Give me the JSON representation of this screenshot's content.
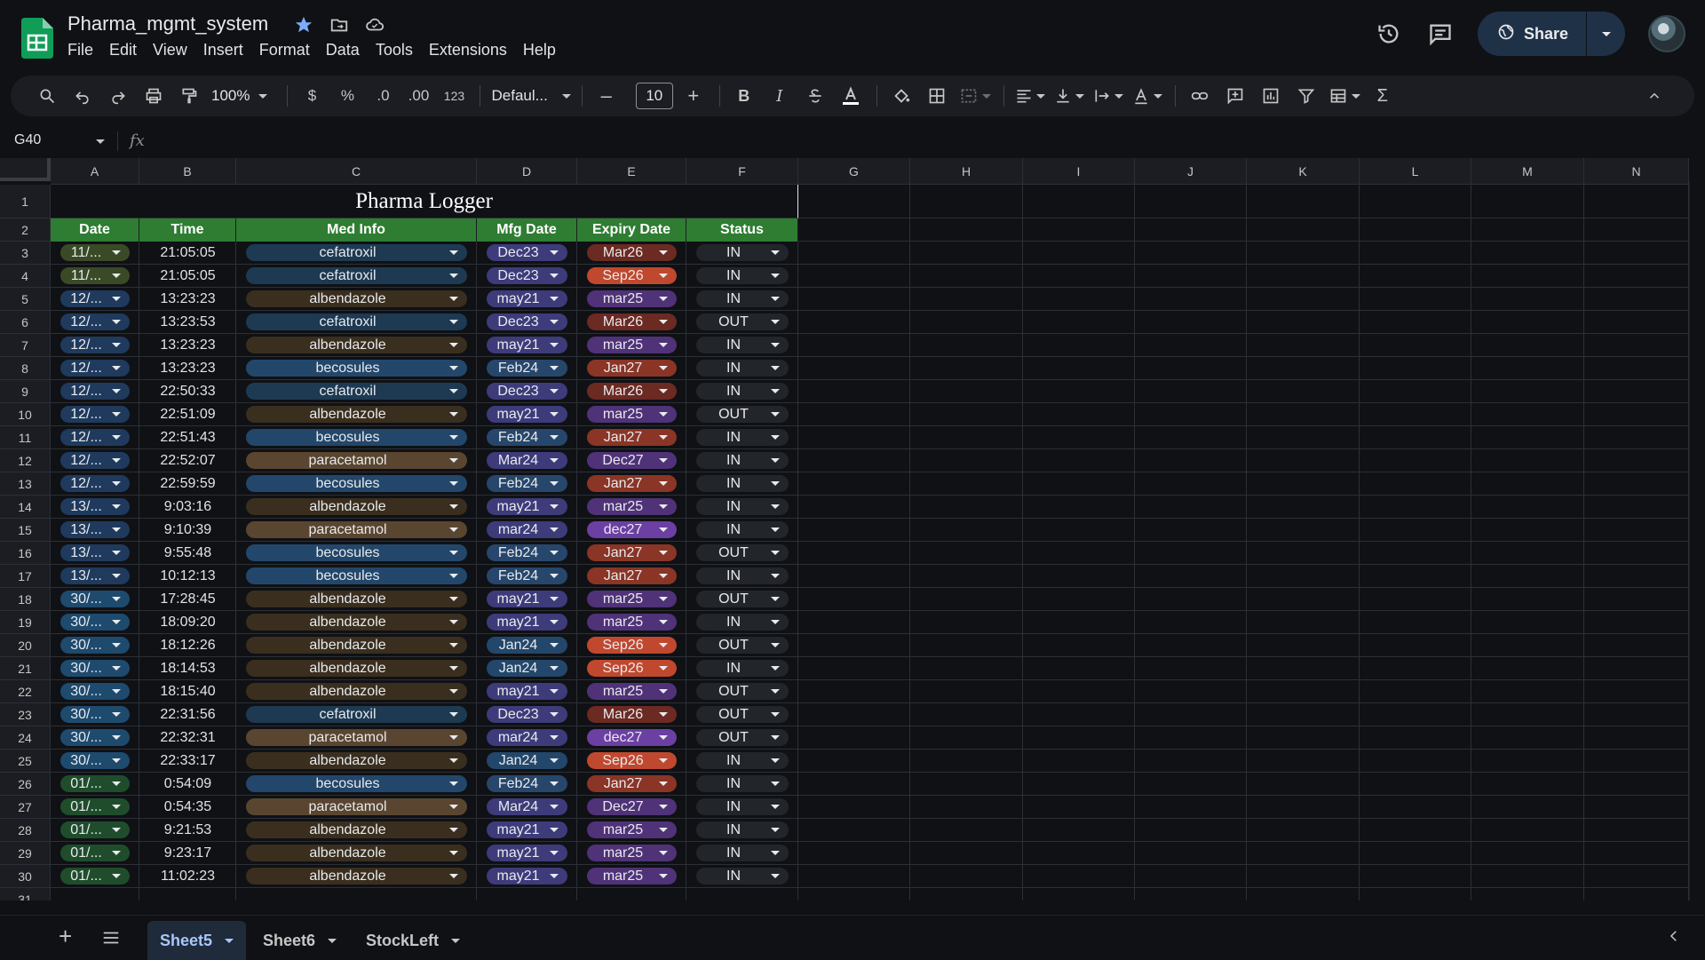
{
  "document": {
    "title": "Pharma_mgmt_system"
  },
  "menu": [
    "File",
    "Edit",
    "View",
    "Insert",
    "Format",
    "Data",
    "Tools",
    "Extensions",
    "Help"
  ],
  "header": {
    "share_label": "Share"
  },
  "toolbar": {
    "zoom": "100%",
    "currency": "$",
    "percent": "%",
    "dec_decrease": ".0",
    "dec_increase": ".00",
    "format_123": "123",
    "font": "Defaul...",
    "font_size": "10",
    "bold": "B",
    "italic": "I"
  },
  "formula_bar": {
    "cell_ref": "G40",
    "fx": "fx"
  },
  "columns": [
    "A",
    "B",
    "C",
    "D",
    "E",
    "F",
    "G",
    "H",
    "I",
    "J",
    "K",
    "L",
    "M",
    "N"
  ],
  "sheet": {
    "title": "Pharma Logger",
    "headers": [
      "Date",
      "Time",
      "Med Info",
      "Mfg Date",
      "Expiry Date",
      "Status"
    ],
    "rows": [
      {
        "n": "3",
        "date": "11/...",
        "time": "21:05:05",
        "med": "cefatroxil",
        "mfg": "Dec23",
        "exp": "Mar26",
        "status": "IN"
      },
      {
        "n": "4",
        "date": "11/...",
        "time": "21:05:05",
        "med": "cefatroxil",
        "mfg": "Dec23",
        "exp": "Sep26",
        "status": "IN"
      },
      {
        "n": "5",
        "date": "12/...",
        "time": "13:23:23",
        "med": "albendazole",
        "mfg": "may21",
        "exp": "mar25",
        "status": "IN"
      },
      {
        "n": "6",
        "date": "12/...",
        "time": "13:23:53",
        "med": "cefatroxil",
        "mfg": "Dec23",
        "exp": "Mar26",
        "status": "OUT"
      },
      {
        "n": "7",
        "date": "12/...",
        "time": "13:23:23",
        "med": "albendazole",
        "mfg": "may21",
        "exp": "mar25",
        "status": "IN"
      },
      {
        "n": "8",
        "date": "12/...",
        "time": "13:23:23",
        "med": "becosules",
        "mfg": "Feb24",
        "exp": "Jan27",
        "status": "IN"
      },
      {
        "n": "9",
        "date": "12/...",
        "time": "22:50:33",
        "med": "cefatroxil",
        "mfg": "Dec23",
        "exp": "Mar26",
        "status": "IN"
      },
      {
        "n": "10",
        "date": "12/...",
        "time": "22:51:09",
        "med": "albendazole",
        "mfg": "may21",
        "exp": "mar25",
        "status": "OUT"
      },
      {
        "n": "11",
        "date": "12/...",
        "time": "22:51:43",
        "med": "becosules",
        "mfg": "Feb24",
        "exp": "Jan27",
        "status": "IN"
      },
      {
        "n": "12",
        "date": "12/...",
        "time": "22:52:07",
        "med": "paracetamol",
        "mfg": "Mar24",
        "exp": "Dec27",
        "status": "IN"
      },
      {
        "n": "13",
        "date": "12/...",
        "time": "22:59:59",
        "med": "becosules",
        "mfg": "Feb24",
        "exp": "Jan27",
        "status": "IN"
      },
      {
        "n": "14",
        "date": "13/...",
        "time": "9:03:16",
        "med": "albendazole",
        "mfg": "may21",
        "exp": "mar25",
        "status": "IN"
      },
      {
        "n": "15",
        "date": "13/...",
        "time": "9:10:39",
        "med": "paracetamol",
        "mfg": "mar24",
        "exp": "dec27",
        "status": "IN"
      },
      {
        "n": "16",
        "date": "13/...",
        "time": "9:55:48",
        "med": "becosules",
        "mfg": "Feb24",
        "exp": "Jan27",
        "status": "OUT"
      },
      {
        "n": "17",
        "date": "13/...",
        "time": "10:12:13",
        "med": "becosules",
        "mfg": "Feb24",
        "exp": "Jan27",
        "status": "IN"
      },
      {
        "n": "18",
        "date": "30/...",
        "time": "17:28:45",
        "med": "albendazole",
        "mfg": "may21",
        "exp": "mar25",
        "status": "OUT"
      },
      {
        "n": "19",
        "date": "30/...",
        "time": "18:09:20",
        "med": "albendazole",
        "mfg": "may21",
        "exp": "mar25",
        "status": "IN"
      },
      {
        "n": "20",
        "date": "30/...",
        "time": "18:12:26",
        "med": "albendazole",
        "mfg": "Jan24",
        "exp": "Sep26",
        "status": "OUT"
      },
      {
        "n": "21",
        "date": "30/...",
        "time": "18:14:53",
        "med": "albendazole",
        "mfg": "Jan24",
        "exp": "Sep26",
        "status": "IN"
      },
      {
        "n": "22",
        "date": "30/...",
        "time": "18:15:40",
        "med": "albendazole",
        "mfg": "may21",
        "exp": "mar25",
        "status": "OUT"
      },
      {
        "n": "23",
        "date": "30/...",
        "time": "22:31:56",
        "med": "cefatroxil",
        "mfg": "Dec23",
        "exp": "Mar26",
        "status": "OUT"
      },
      {
        "n": "24",
        "date": "30/...",
        "time": "22:32:31",
        "med": "paracetamol",
        "mfg": "mar24",
        "exp": "dec27",
        "status": "OUT"
      },
      {
        "n": "25",
        "date": "30/...",
        "time": "22:33:17",
        "med": "albendazole",
        "mfg": "Jan24",
        "exp": "Sep26",
        "status": "IN"
      },
      {
        "n": "26",
        "date": "01/...",
        "time": "0:54:09",
        "med": "becosules",
        "mfg": "Feb24",
        "exp": "Jan27",
        "status": "IN"
      },
      {
        "n": "27",
        "date": "01/...",
        "time": "0:54:35",
        "med": "paracetamol",
        "mfg": "Mar24",
        "exp": "Dec27",
        "status": "IN"
      },
      {
        "n": "28",
        "date": "01/...",
        "time": "9:21:53",
        "med": "albendazole",
        "mfg": "may21",
        "exp": "mar25",
        "status": "IN"
      },
      {
        "n": "29",
        "date": "01/...",
        "time": "9:23:17",
        "med": "albendazole",
        "mfg": "may21",
        "exp": "mar25",
        "status": "IN"
      },
      {
        "n": "30",
        "date": "01/...",
        "time": "11:02:23",
        "med": "albendazole",
        "mfg": "may21",
        "exp": "mar25",
        "status": "IN"
      }
    ],
    "partial_row": "31"
  },
  "sheet_tabs": [
    {
      "label": "Sheet5",
      "active": true
    },
    {
      "label": "Sheet6",
      "active": false
    },
    {
      "label": "StockLeft",
      "active": false
    }
  ],
  "colors": {
    "header_green": "#2e7d32",
    "accent_blue": "#a8c7fa",
    "share_bg": "#1f3147"
  },
  "icons": [
    "sheets-logo-icon",
    "star-icon",
    "move-folder-icon",
    "cloud-status-icon",
    "history-icon",
    "comment-icon",
    "globe-icon",
    "search-icon",
    "undo-icon",
    "redo-icon",
    "print-icon",
    "paint-format-icon",
    "bold-icon",
    "italic-icon",
    "strikethrough-icon",
    "text-color-icon",
    "fill-color-icon",
    "borders-icon",
    "merge-icon",
    "align-icon",
    "valign-icon",
    "wrap-icon",
    "rotate-icon",
    "link-icon",
    "comment-add-icon",
    "chart-icon",
    "filter-icon",
    "table-icon",
    "sum-icon",
    "collapse-icon",
    "add-sheet-icon",
    "all-sheets-icon"
  ]
}
